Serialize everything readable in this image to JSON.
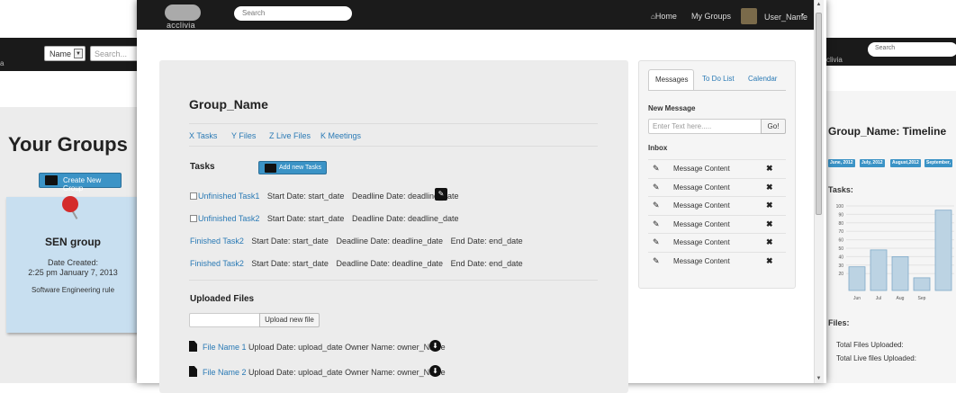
{
  "left_window": {
    "logo_fragment": "a",
    "select_value": "Name",
    "select_caret": "▼",
    "search_placeholder": "Search...",
    "heading": "Your Groups",
    "create_button": "Create New Group",
    "group_card": {
      "name": "SEN group",
      "date_label": "Date Created:",
      "date_value": "2:25 pm January 7, 2013",
      "description": "Software Engineering rule"
    }
  },
  "main_window": {
    "nav": {
      "logo_text": "acclivia",
      "search_placeholder": "Search",
      "home_glyph": "⌂",
      "home": "Home",
      "my_groups": "My Groups",
      "user": "User_Name",
      "user_caret": "▾"
    },
    "scrollbar": {
      "up": "▲",
      "down": "▼"
    },
    "group": {
      "name": "Group_Name",
      "stats": [
        "X Tasks",
        "Y Files",
        "Z Live Files",
        "K Meetings"
      ],
      "tasks_heading": "Tasks",
      "add_task_button": "Add new Tasks",
      "edit_glyph": "✎",
      "tasks": [
        {
          "name": "Unfinished Task1",
          "start": "Start Date: start_date",
          "deadline": "Deadline Date: deadline_date",
          "end": "",
          "checkbox": true
        },
        {
          "name": "Unfinished Task2",
          "start": "Start Date: start_date",
          "deadline": "Deadline Date: deadline_date",
          "end": "",
          "checkbox": true
        },
        {
          "name": "Finished Task2",
          "start": "Start Date: start_date",
          "deadline": "Deadline Date: deadline_date",
          "end": "End Date: end_date",
          "checkbox": false
        },
        {
          "name": "Finished Task2",
          "start": "Start Date: start_date",
          "deadline": "Deadline Date: deadline_date",
          "end": "End Date: end_date",
          "checkbox": false
        }
      ],
      "files_heading": "Uploaded Files",
      "upload_button": "Upload new file",
      "download_glyph": "⬇",
      "files": [
        {
          "name": "File Name 1",
          "date": "Upload Date: upload_date",
          "owner": "Owner Name: owner_Name"
        },
        {
          "name": "File Name 2",
          "date": "Upload Date: upload_date",
          "owner": "Owner Name: owner_Name"
        }
      ]
    },
    "sidebar": {
      "tabs": [
        "Messages",
        "To Do List",
        "Calendar"
      ],
      "active_tab": "Messages",
      "new_message_label": "New Message",
      "message_placeholder": "Enter Text here.....",
      "go_button": "Go!",
      "inbox_label": "Inbox",
      "edit_glyph": "✎",
      "delete_glyph": "✖",
      "messages": [
        "Message Content",
        "Message Content",
        "Message Content",
        "Message Content",
        "Message Content",
        "Message Content"
      ]
    }
  },
  "right_window": {
    "logo_fragment": "cclivia",
    "search_placeholder": "Search",
    "title": "Group_Name: Timeline",
    "months": [
      "June, 2012",
      "July, 2012",
      "August,2012",
      "September,"
    ],
    "tasks_label": "Tasks:",
    "files_label": "Files:",
    "total_files": "Total Files Uploaded:",
    "total_live_files": "Total Live files Uploaded:"
  },
  "chart_data": {
    "type": "bar",
    "categories": [
      "Jun",
      "Jul",
      "Aug",
      "Sep",
      ""
    ],
    "values": [
      28,
      48,
      40,
      15,
      95
    ],
    "ylim": [
      0,
      100
    ],
    "yticks": [
      20,
      30,
      40,
      50,
      60,
      70,
      80,
      90,
      100
    ],
    "grid": true,
    "bar_color": "#bcd3e3",
    "bar_stroke": "#7faac8"
  },
  "colors": {
    "navbar": "#1b1b1b",
    "accent": "#3b93c6",
    "link": "#2a7ab5",
    "panel": "#ececec"
  }
}
